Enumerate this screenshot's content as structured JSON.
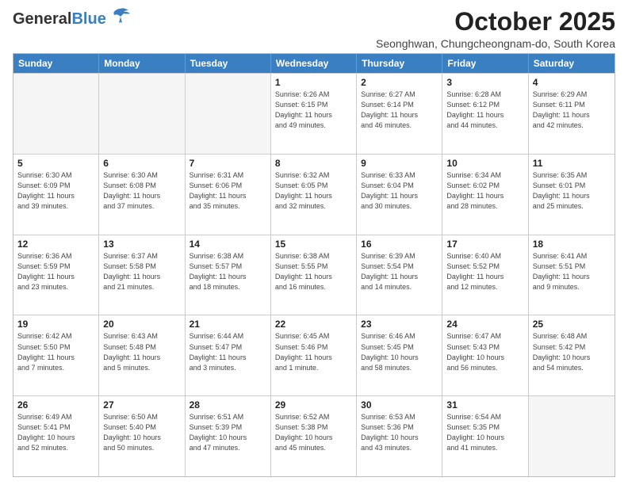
{
  "logo": {
    "line1": "General",
    "line2": "Blue"
  },
  "title": "October 2025",
  "subtitle": "Seonghwan, Chungcheongnam-do, South Korea",
  "headers": [
    "Sunday",
    "Monday",
    "Tuesday",
    "Wednesday",
    "Thursday",
    "Friday",
    "Saturday"
  ],
  "rows": [
    [
      {
        "day": "",
        "info": ""
      },
      {
        "day": "",
        "info": ""
      },
      {
        "day": "",
        "info": ""
      },
      {
        "day": "1",
        "info": "Sunrise: 6:26 AM\nSunset: 6:15 PM\nDaylight: 11 hours\nand 49 minutes."
      },
      {
        "day": "2",
        "info": "Sunrise: 6:27 AM\nSunset: 6:14 PM\nDaylight: 11 hours\nand 46 minutes."
      },
      {
        "day": "3",
        "info": "Sunrise: 6:28 AM\nSunset: 6:12 PM\nDaylight: 11 hours\nand 44 minutes."
      },
      {
        "day": "4",
        "info": "Sunrise: 6:29 AM\nSunset: 6:11 PM\nDaylight: 11 hours\nand 42 minutes."
      }
    ],
    [
      {
        "day": "5",
        "info": "Sunrise: 6:30 AM\nSunset: 6:09 PM\nDaylight: 11 hours\nand 39 minutes."
      },
      {
        "day": "6",
        "info": "Sunrise: 6:30 AM\nSunset: 6:08 PM\nDaylight: 11 hours\nand 37 minutes."
      },
      {
        "day": "7",
        "info": "Sunrise: 6:31 AM\nSunset: 6:06 PM\nDaylight: 11 hours\nand 35 minutes."
      },
      {
        "day": "8",
        "info": "Sunrise: 6:32 AM\nSunset: 6:05 PM\nDaylight: 11 hours\nand 32 minutes."
      },
      {
        "day": "9",
        "info": "Sunrise: 6:33 AM\nSunset: 6:04 PM\nDaylight: 11 hours\nand 30 minutes."
      },
      {
        "day": "10",
        "info": "Sunrise: 6:34 AM\nSunset: 6:02 PM\nDaylight: 11 hours\nand 28 minutes."
      },
      {
        "day": "11",
        "info": "Sunrise: 6:35 AM\nSunset: 6:01 PM\nDaylight: 11 hours\nand 25 minutes."
      }
    ],
    [
      {
        "day": "12",
        "info": "Sunrise: 6:36 AM\nSunset: 5:59 PM\nDaylight: 11 hours\nand 23 minutes."
      },
      {
        "day": "13",
        "info": "Sunrise: 6:37 AM\nSunset: 5:58 PM\nDaylight: 11 hours\nand 21 minutes."
      },
      {
        "day": "14",
        "info": "Sunrise: 6:38 AM\nSunset: 5:57 PM\nDaylight: 11 hours\nand 18 minutes."
      },
      {
        "day": "15",
        "info": "Sunrise: 6:38 AM\nSunset: 5:55 PM\nDaylight: 11 hours\nand 16 minutes."
      },
      {
        "day": "16",
        "info": "Sunrise: 6:39 AM\nSunset: 5:54 PM\nDaylight: 11 hours\nand 14 minutes."
      },
      {
        "day": "17",
        "info": "Sunrise: 6:40 AM\nSunset: 5:52 PM\nDaylight: 11 hours\nand 12 minutes."
      },
      {
        "day": "18",
        "info": "Sunrise: 6:41 AM\nSunset: 5:51 PM\nDaylight: 11 hours\nand 9 minutes."
      }
    ],
    [
      {
        "day": "19",
        "info": "Sunrise: 6:42 AM\nSunset: 5:50 PM\nDaylight: 11 hours\nand 7 minutes."
      },
      {
        "day": "20",
        "info": "Sunrise: 6:43 AM\nSunset: 5:48 PM\nDaylight: 11 hours\nand 5 minutes."
      },
      {
        "day": "21",
        "info": "Sunrise: 6:44 AM\nSunset: 5:47 PM\nDaylight: 11 hours\nand 3 minutes."
      },
      {
        "day": "22",
        "info": "Sunrise: 6:45 AM\nSunset: 5:46 PM\nDaylight: 11 hours\nand 1 minute."
      },
      {
        "day": "23",
        "info": "Sunrise: 6:46 AM\nSunset: 5:45 PM\nDaylight: 10 hours\nand 58 minutes."
      },
      {
        "day": "24",
        "info": "Sunrise: 6:47 AM\nSunset: 5:43 PM\nDaylight: 10 hours\nand 56 minutes."
      },
      {
        "day": "25",
        "info": "Sunrise: 6:48 AM\nSunset: 5:42 PM\nDaylight: 10 hours\nand 54 minutes."
      }
    ],
    [
      {
        "day": "26",
        "info": "Sunrise: 6:49 AM\nSunset: 5:41 PM\nDaylight: 10 hours\nand 52 minutes."
      },
      {
        "day": "27",
        "info": "Sunrise: 6:50 AM\nSunset: 5:40 PM\nDaylight: 10 hours\nand 50 minutes."
      },
      {
        "day": "28",
        "info": "Sunrise: 6:51 AM\nSunset: 5:39 PM\nDaylight: 10 hours\nand 47 minutes."
      },
      {
        "day": "29",
        "info": "Sunrise: 6:52 AM\nSunset: 5:38 PM\nDaylight: 10 hours\nand 45 minutes."
      },
      {
        "day": "30",
        "info": "Sunrise: 6:53 AM\nSunset: 5:36 PM\nDaylight: 10 hours\nand 43 minutes."
      },
      {
        "day": "31",
        "info": "Sunrise: 6:54 AM\nSunset: 5:35 PM\nDaylight: 10 hours\nand 41 minutes."
      },
      {
        "day": "",
        "info": ""
      }
    ]
  ]
}
